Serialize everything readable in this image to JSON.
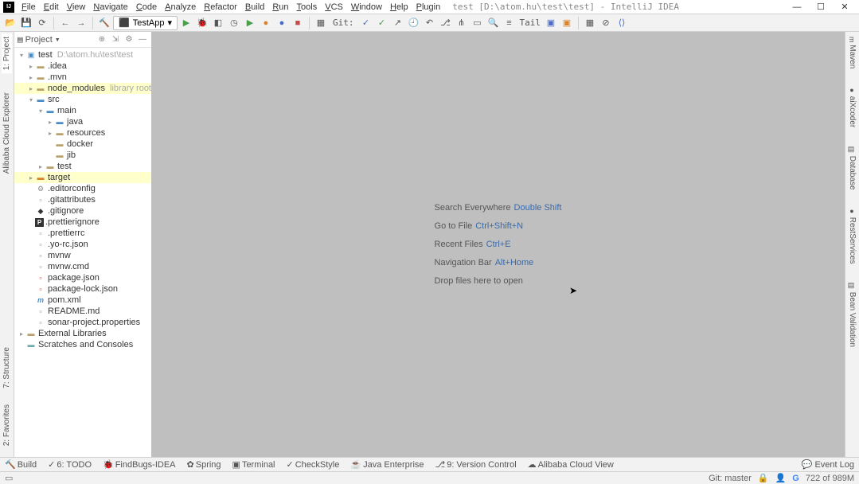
{
  "title": "test [D:\\atom.hu\\test\\test] - IntelliJ IDEA",
  "menu": [
    "File",
    "Edit",
    "View",
    "Navigate",
    "Code",
    "Analyze",
    "Refactor",
    "Build",
    "Run",
    "Tools",
    "VCS",
    "Window",
    "Help",
    "Plugin"
  ],
  "toolbar": {
    "run_config": "TestApp",
    "git_label": "Git:",
    "tail_label": "Tail"
  },
  "panel": {
    "title": "Project"
  },
  "project_root": {
    "name": "test",
    "path": "D:\\atom.hu\\test\\test"
  },
  "tree": [
    {
      "d": 0,
      "exp": "v",
      "ic": "pf",
      "label": "test",
      "suffix": "D:\\atom.hu\\test\\test",
      "hl": false
    },
    {
      "d": 1,
      "exp": ">",
      "ic": "f",
      "label": ".idea"
    },
    {
      "d": 1,
      "exp": ">",
      "ic": "f",
      "label": ".mvn"
    },
    {
      "d": 1,
      "exp": ">",
      "ic": "f",
      "label": "node_modules",
      "suffix": "library root",
      "hl": true
    },
    {
      "d": 1,
      "exp": "v",
      "ic": "fb",
      "label": "src"
    },
    {
      "d": 2,
      "exp": "v",
      "ic": "fb",
      "label": "main"
    },
    {
      "d": 3,
      "exp": ">",
      "ic": "fb",
      "label": "java"
    },
    {
      "d": 3,
      "exp": ">",
      "ic": "f",
      "label": "resources"
    },
    {
      "d": 3,
      "exp": "",
      "ic": "f",
      "label": "docker"
    },
    {
      "d": 3,
      "exp": "",
      "ic": "f",
      "label": "jib"
    },
    {
      "d": 2,
      "exp": ">",
      "ic": "f",
      "label": "test"
    },
    {
      "d": 1,
      "exp": ">",
      "ic": "fo",
      "label": "target",
      "hl": true
    },
    {
      "d": 1,
      "exp": "",
      "ic": "gear",
      "label": ".editorconfig"
    },
    {
      "d": 1,
      "exp": "",
      "ic": "file",
      "label": ".gitattributes"
    },
    {
      "d": 1,
      "exp": "",
      "ic": "diam",
      "label": ".gitignore"
    },
    {
      "d": 1,
      "exp": "",
      "ic": "P",
      "label": ".prettierignore"
    },
    {
      "d": 1,
      "exp": "",
      "ic": "file",
      "label": ".prettierrc"
    },
    {
      "d": 1,
      "exp": "",
      "ic": "file",
      "label": ".yo-rc.json"
    },
    {
      "d": 1,
      "exp": "",
      "ic": "file",
      "label": "mvnw"
    },
    {
      "d": 1,
      "exp": "",
      "ic": "file",
      "label": "mvnw.cmd"
    },
    {
      "d": 1,
      "exp": "",
      "ic": "npm",
      "label": "package.json"
    },
    {
      "d": 1,
      "exp": "",
      "ic": "npm",
      "label": "package-lock.json"
    },
    {
      "d": 1,
      "exp": "",
      "ic": "m",
      "label": "pom.xml"
    },
    {
      "d": 1,
      "exp": "",
      "ic": "file",
      "label": "README.md"
    },
    {
      "d": 1,
      "exp": "",
      "ic": "file",
      "label": "sonar-project.properties"
    }
  ],
  "tree_footer": [
    {
      "label": "External Libraries",
      "ic": "lib",
      "exp": ">"
    },
    {
      "label": "Scratches and Consoles",
      "ic": "scr",
      "exp": ""
    }
  ],
  "tips": [
    {
      "text": "Search Everywhere",
      "shortcut": "Double Shift"
    },
    {
      "text": "Go to File",
      "shortcut": "Ctrl+Shift+N"
    },
    {
      "text": "Recent Files",
      "shortcut": "Ctrl+E"
    },
    {
      "text": "Navigation Bar",
      "shortcut": "Alt+Home"
    },
    {
      "text": "Drop files here to open",
      "shortcut": ""
    }
  ],
  "left_tabs": {
    "project": "1: Project",
    "alibaba": "Alibaba Cloud Explorer",
    "structure": "7: Structure",
    "favorites": "2: Favorites"
  },
  "right_tabs": [
    "Maven",
    "aiXcoder",
    "Database",
    "RestServices",
    "Bean Validation"
  ],
  "bottom_tabs": [
    "Build",
    "6: TODO",
    "FindBugs-IDEA",
    "Spring",
    "Terminal",
    "CheckStyle",
    "Java Enterprise",
    "9: Version Control",
    "Alibaba Cloud View"
  ],
  "bottom_right": "Event Log",
  "status": {
    "git": "Git: master",
    "mem": "722 of 989M"
  }
}
